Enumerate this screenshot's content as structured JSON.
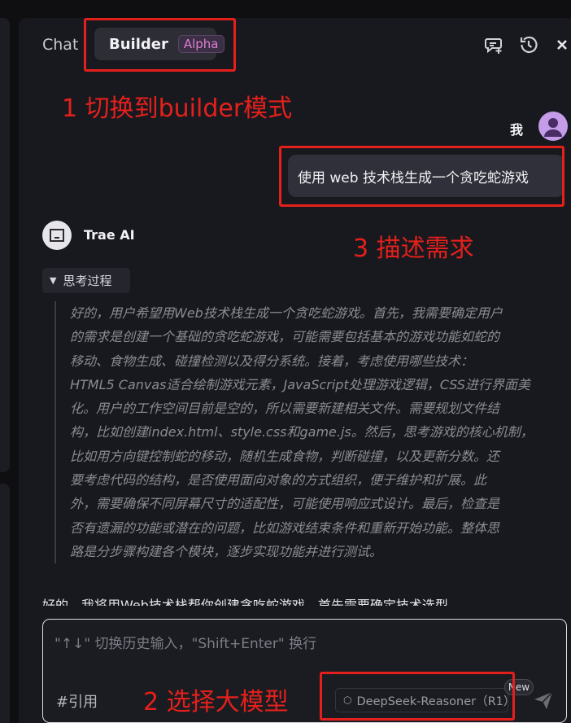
{
  "header": {
    "tab_chat": "Chat",
    "tab_builder": "Builder",
    "builder_badge": "Alpha",
    "icons": [
      "new-chat-icon",
      "history-icon",
      "close-icon"
    ]
  },
  "annotations": {
    "step1": "1 切换到builder模式",
    "step2": "2 选择大模型",
    "step3": "3 描述需求",
    "color": "#e5201c"
  },
  "user_message": {
    "name": "我",
    "text": "使用 web 技术栈生成一个贪吃蛇游戏"
  },
  "ai": {
    "name": "Trae AI",
    "thinking_label": "思考过程",
    "thinking_lines": [
      "好的，用户希望用Web技术栈生成一个贪吃蛇游戏。首先，我需要确定用户",
      "的需求是创建一个基础的贪吃蛇游戏，可能需要包括基本的游戏功能如蛇的",
      "移动、食物生成、碰撞检测以及得分系统。接着，考虑使用哪些技术：",
      "HTML5 Canvas适合绘制游戏元素，JavaScript处理游戏逻辑，CSS进行界面美",
      "化。用户的工作空间目前是空的，所以需要新建相关文件。需要规划文件结",
      "构，比如创建index.html、style.css和game.js。然后，思考游戏的核心机制，",
      "比如用方向键控制蛇的移动，随机生成食物，判断碰撞，以及更新分数。还",
      "要考虑代码的结构，是否使用面向对象的方式组织，便于维护和扩展。此",
      "外，需要确保不同屏幕尺寸的适配性，可能使用响应式设计。最后，检查是",
      "否有遗漏的功能或潜在的问题，比如游戏结束条件和重新开始功能。整体思",
      "路是分步骤构建各个模块，逐步实现功能并进行测试。"
    ],
    "answer_partial": "好的，我将用Web技术栈帮你创建贪吃蛇游戏。首先需要确定技术选型"
  },
  "input": {
    "placeholder": "\"↑↓\" 切换历史输入，\"Shift+Enter\" 换行",
    "reference_label": "#引用",
    "model": "DeepSeek-Reasoner（R1）",
    "new_badge": "New"
  }
}
